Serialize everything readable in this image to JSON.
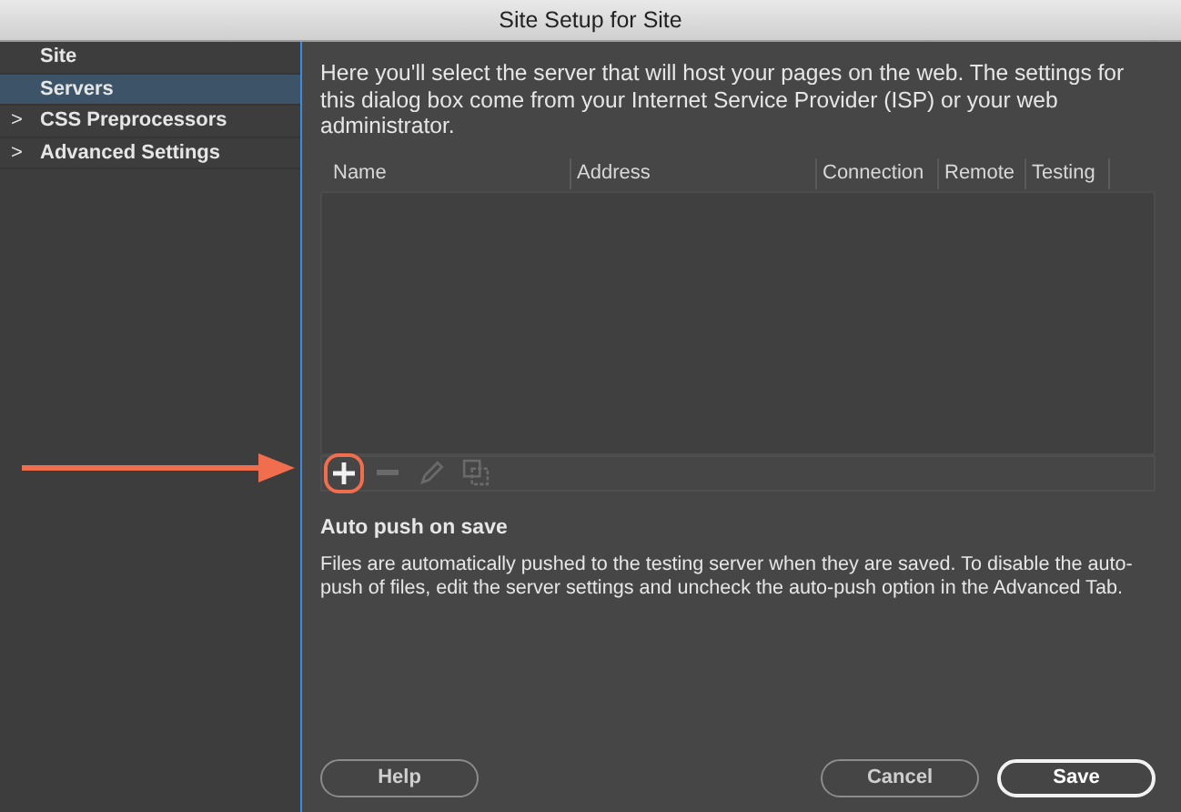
{
  "window": {
    "title": "Site Setup for Site"
  },
  "sidebar": {
    "items": [
      {
        "label": "Site",
        "selected": false
      },
      {
        "label": "Servers",
        "selected": true
      },
      {
        "label": "CSS Preprocessors",
        "selected": false,
        "expander": ">"
      },
      {
        "label": "Advanced Settings",
        "selected": false,
        "expander": ">"
      }
    ]
  },
  "intro": "Here you'll select the server that will host your pages on the web. The settings for this dialog box come from your Internet Service Provider (ISP) or your web administrator.",
  "table": {
    "columns": [
      "Name",
      "Address",
      "Connection",
      "Remote",
      "Testing"
    ]
  },
  "toolbar": [
    {
      "kind": "add",
      "disabled": false,
      "highlighted": true
    },
    {
      "kind": "remove",
      "disabled": true,
      "highlighted": false
    },
    {
      "kind": "edit",
      "disabled": true,
      "highlighted": false
    },
    {
      "kind": "duplicate",
      "disabled": true,
      "highlighted": false
    }
  ],
  "auto_push": {
    "heading": "Auto push on save",
    "text": "Files are automatically pushed to the testing server when they are saved. To disable the auto-push of files, edit the server settings and uncheck the auto-push option in the Advanced Tab."
  },
  "buttons": [
    {
      "label": "Help",
      "default": false
    },
    {
      "label": "Cancel",
      "default": false
    },
    {
      "label": "Save",
      "default": true
    }
  ]
}
